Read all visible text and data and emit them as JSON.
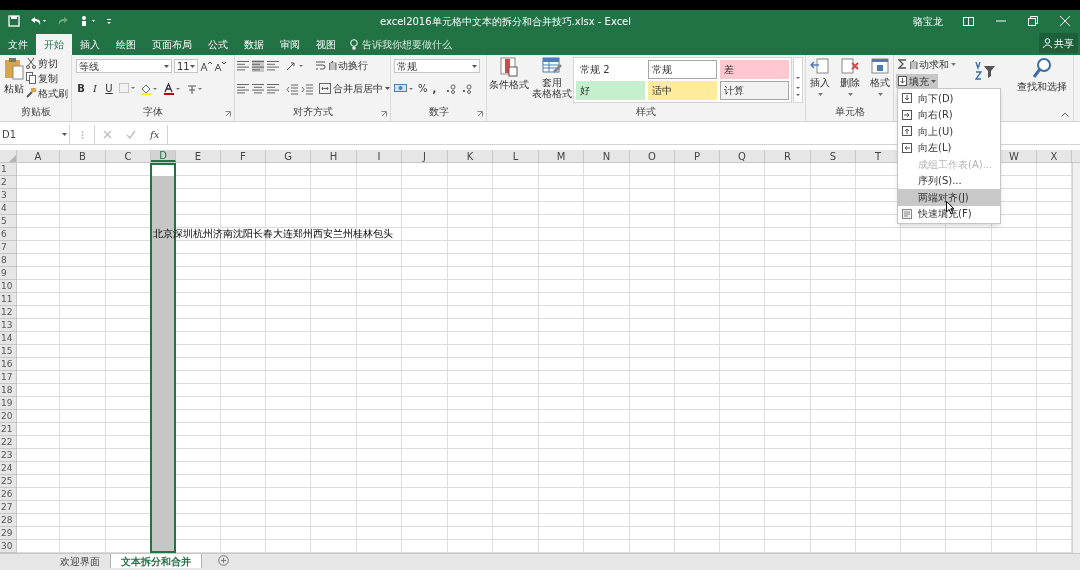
{
  "title_bar": {
    "title": "excel2016单元格中文本的拆分和合并技巧.xlsx - Excel",
    "user": "骆宝龙"
  },
  "tabs": [
    {
      "label": "文件",
      "selected": false
    },
    {
      "label": "开始",
      "selected": true
    },
    {
      "label": "插入",
      "selected": false
    },
    {
      "label": "绘图",
      "selected": false
    },
    {
      "label": "页面布局",
      "selected": false
    },
    {
      "label": "公式",
      "selected": false
    },
    {
      "label": "数据",
      "selected": false
    },
    {
      "label": "审阅",
      "selected": false
    },
    {
      "label": "视图",
      "selected": false
    }
  ],
  "tell_me": "告诉我你想要做什么",
  "share": "共享",
  "ribbon": {
    "clipboard": {
      "paste": "粘贴",
      "cut": "剪切",
      "copy": "复制",
      "format_painter": "格式刷",
      "label": "剪贴板"
    },
    "font": {
      "name": "等线",
      "size": "11",
      "bold": "B",
      "italic": "I",
      "underline": "U",
      "label": "字体"
    },
    "alignment": {
      "wrap": "自动换行",
      "merge": "合并后居中",
      "label": "对齐方式"
    },
    "number": {
      "format": "常规",
      "percent": "%",
      "comma": ",",
      "label": "数字"
    },
    "styles": {
      "conditional": "条件格式",
      "table_line_1": "套用",
      "table_line_2": "表格格式",
      "label": "样式",
      "cell_styles": [
        {
          "label": "常规 2",
          "color": "#ffffff"
        },
        {
          "label": "常规",
          "color": "#ffffff"
        },
        {
          "label": "差",
          "color": "#ffc7ce"
        },
        {
          "label": "好",
          "color": "#c6efce"
        },
        {
          "label": "适中",
          "color": "#ffeb9c"
        },
        {
          "label": "计算",
          "color": "#f2f2f2"
        }
      ]
    },
    "cells": {
      "items": [
        "插入",
        "删除",
        "格式"
      ],
      "label": "单元格"
    },
    "editing": {
      "autosum": "自动求和",
      "fill": "填充",
      "find": "查找和选择"
    }
  },
  "formula_bar": {
    "name_box": "D1",
    "fx": "fx"
  },
  "sheet": {
    "columns": [
      {
        "label": "A",
        "selected": false
      },
      {
        "label": "B",
        "selected": false
      },
      {
        "label": "C",
        "selected": false
      },
      {
        "label": "D",
        "selected": true
      },
      {
        "label": "E",
        "selected": false
      },
      {
        "label": "F",
        "selected": false
      },
      {
        "label": "G",
        "selected": false
      },
      {
        "label": "H",
        "selected": false
      },
      {
        "label": "I",
        "selected": false
      },
      {
        "label": "J",
        "selected": false
      },
      {
        "label": "K",
        "selected": false
      },
      {
        "label": "L",
        "selected": false
      },
      {
        "label": "M",
        "selected": false
      },
      {
        "label": "N",
        "selected": false
      },
      {
        "label": "O",
        "selected": false
      },
      {
        "label": "P",
        "selected": false
      },
      {
        "label": "Q",
        "selected": false
      },
      {
        "label": "R",
        "selected": false
      },
      {
        "label": "S",
        "selected": false
      },
      {
        "label": "T",
        "selected": false
      },
      {
        "label": "W",
        "selected": false
      },
      {
        "label": "X",
        "selected": false
      }
    ],
    "row_numbers": [
      "1",
      "2",
      "3",
      "4",
      "5",
      "6",
      "7",
      "8",
      "9",
      "10",
      "11",
      "12",
      "13",
      "14",
      "15",
      "16",
      "17",
      "18",
      "19",
      "20",
      "21",
      "22",
      "23",
      "24",
      "25",
      "26",
      "27",
      "28",
      "29",
      "30"
    ],
    "cell_text": "北京深圳杭州济南沈阳长春大连郑州西安兰州桂林包头"
  },
  "fill_menu": {
    "items": [
      {
        "label": "向下(D)",
        "kind": "down",
        "disabled": false,
        "selected": false
      },
      {
        "label": "向右(R)",
        "kind": "right",
        "disabled": false,
        "selected": false
      },
      {
        "label": "向上(U)",
        "kind": "up",
        "disabled": false,
        "selected": false
      },
      {
        "label": "向左(L)",
        "kind": "left",
        "disabled": false,
        "selected": false
      },
      {
        "label": "成组工作表(A)...",
        "kind": "plain",
        "disabled": true,
        "selected": false
      },
      {
        "label": "序列(S)...",
        "kind": "plain",
        "disabled": false,
        "selected": false
      },
      {
        "label": "两端对齐(J)",
        "kind": "plain",
        "disabled": false,
        "selected": true
      },
      {
        "label": "快速填充(F)",
        "kind": "flash",
        "disabled": false,
        "selected": false
      }
    ]
  },
  "sheet_tabs": [
    {
      "label": "欢迎界面",
      "selected": false
    },
    {
      "label": "文本拆分和合并",
      "selected": true
    }
  ]
}
